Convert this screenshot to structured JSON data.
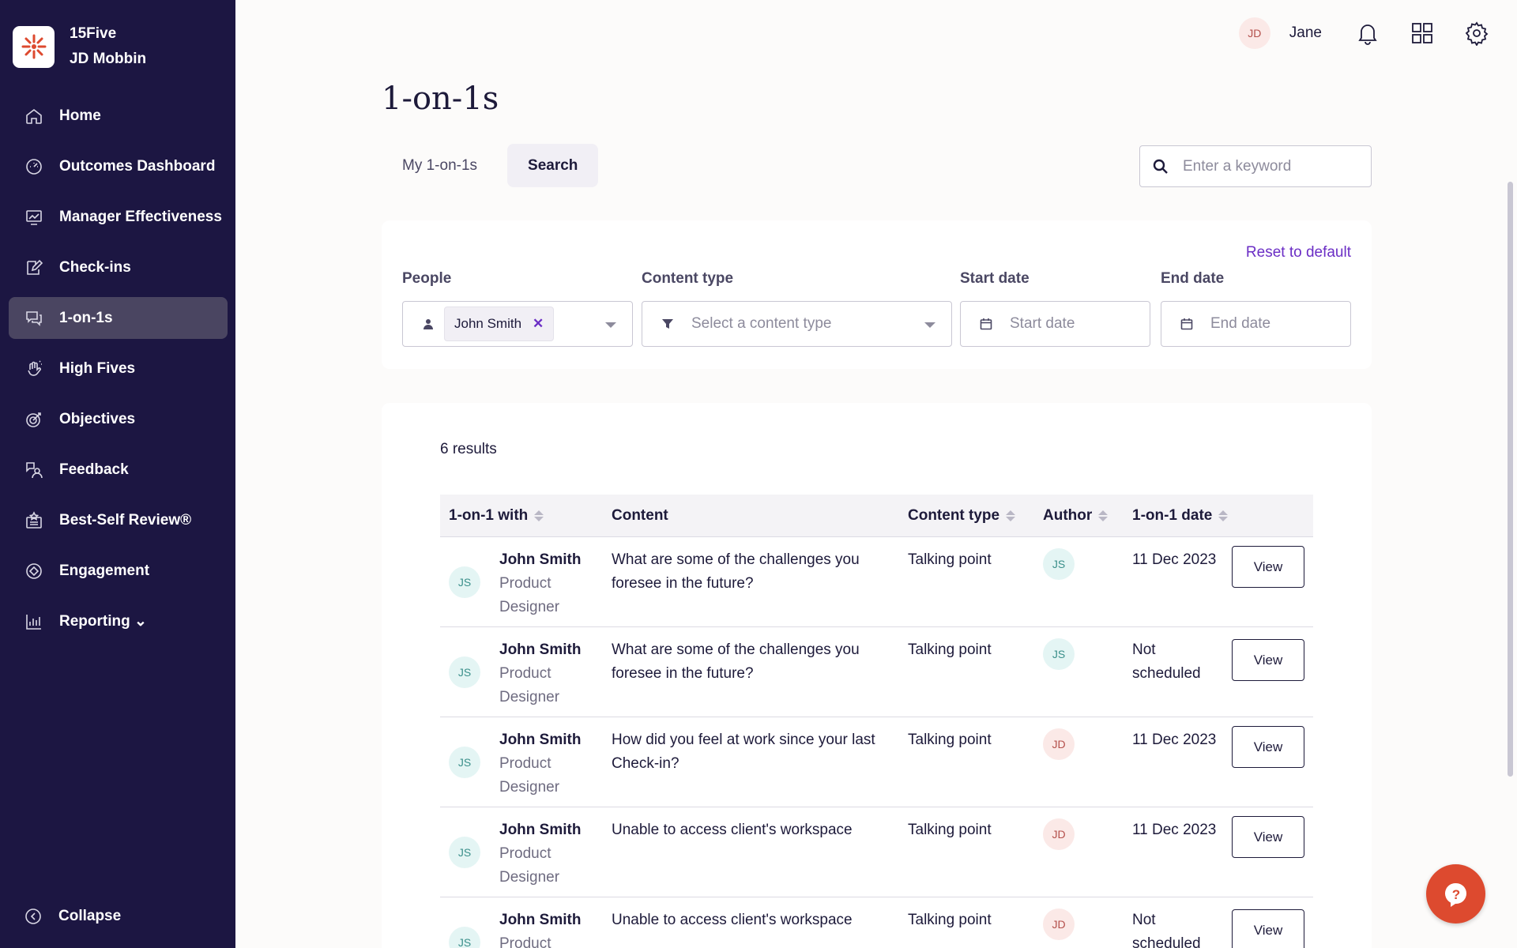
{
  "brand": {
    "company": "15Five",
    "user": "JD Mobbin",
    "accent": "#dd4a2f"
  },
  "sidebar": {
    "items": [
      {
        "label": "Home",
        "icon": "home-icon"
      },
      {
        "label": "Outcomes Dashboard",
        "icon": "gauge-icon"
      },
      {
        "label": "Manager Effectiveness",
        "icon": "chart-board-icon"
      },
      {
        "label": "Check-ins",
        "icon": "edit-icon"
      },
      {
        "label": "1-on-1s",
        "icon": "chat-icon",
        "active": true
      },
      {
        "label": "High Fives",
        "icon": "hand-icon"
      },
      {
        "label": "Objectives",
        "icon": "target-icon"
      },
      {
        "label": "Feedback",
        "icon": "feedback-icon"
      },
      {
        "label": "Best-Self Review®",
        "icon": "review-icon"
      },
      {
        "label": "Engagement",
        "icon": "engagement-icon"
      },
      {
        "label": "Reporting ⌄",
        "icon": "bar-chart-icon"
      }
    ],
    "collapse_label": "Collapse"
  },
  "topbar": {
    "avatar_initials": "JD",
    "user_name": "Jane"
  },
  "page": {
    "title": "1-on-1s",
    "tabs": [
      {
        "label": "My 1-on-1s"
      },
      {
        "label": "Search",
        "active": true
      }
    ],
    "keyword_placeholder": "Enter a keyword"
  },
  "filters": {
    "reset_label": "Reset to default",
    "people_label": "People",
    "people_chip": "John Smith",
    "content_type_label": "Content type",
    "content_type_placeholder": "Select a content type",
    "start_date_label": "Start date",
    "start_date_placeholder": "Start date",
    "end_date_label": "End date",
    "end_date_placeholder": "End date"
  },
  "results": {
    "count": "6 results",
    "columns": {
      "with": "1-on-1 with",
      "content": "Content",
      "content_type": "Content type",
      "author": "Author",
      "date": "1-on-1 date"
    },
    "rows": [
      {
        "initials": "JS",
        "name": "John Smith",
        "role": "Product Designer",
        "content": "What are some of the challenges you foresee in the future?",
        "content_type": "Talking point",
        "author": "JS",
        "date": "11 Dec 2023",
        "action": "View"
      },
      {
        "initials": "JS",
        "name": "John Smith",
        "role": "Product Designer",
        "content": "What are some of the challenges you foresee in the future?",
        "content_type": "Talking point",
        "author": "JS",
        "date": "Not scheduled",
        "action": "View"
      },
      {
        "initials": "JS",
        "name": "John Smith",
        "role": "Product Designer",
        "content": "How did you feel at work since your last Check-in?",
        "content_type": "Talking point",
        "author": "JD",
        "date": "11 Dec 2023",
        "action": "View"
      },
      {
        "initials": "JS",
        "name": "John Smith",
        "role": "Product Designer",
        "content": "Unable to access client's workspace",
        "content_type": "Talking point",
        "author": "JD",
        "date": "11 Dec 2023",
        "action": "View"
      },
      {
        "initials": "JS",
        "name": "John Smith",
        "role": "Product Designer",
        "content": "Unable to access client's workspace",
        "content_type": "Talking point",
        "author": "JD",
        "date": "Not scheduled",
        "action": "View"
      }
    ]
  }
}
